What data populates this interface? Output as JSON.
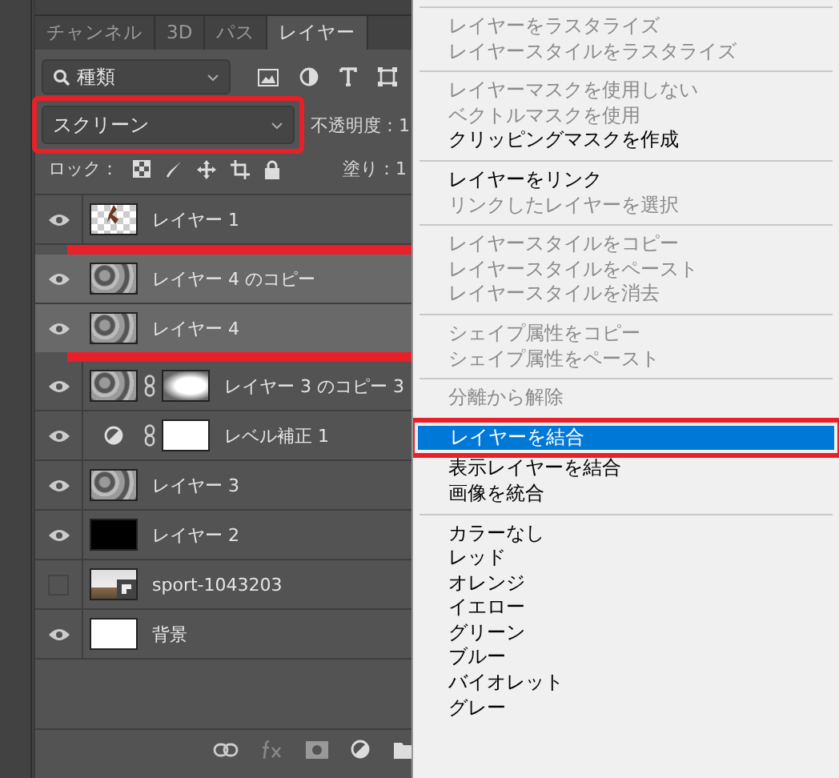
{
  "tabs": [
    {
      "label": "チャンネル",
      "selected": false
    },
    {
      "label": "3D",
      "selected": false
    },
    {
      "label": "パス",
      "selected": false
    },
    {
      "label": "レイヤー",
      "selected": true
    }
  ],
  "filter": {
    "value": "種類"
  },
  "blend_mode": {
    "value": "スクリーン",
    "highlighted": true
  },
  "opacity": {
    "label": "不透明度：1"
  },
  "lock": {
    "label": "ロック："
  },
  "fill": {
    "label": "塗り：1"
  },
  "layers": [
    {
      "name": "レイヤー 1",
      "visible": true,
      "selected": false,
      "highlighted": false,
      "kind": "figure"
    },
    {
      "name": "レイヤー 4 のコピー",
      "visible": true,
      "selected": true,
      "highlighted": true,
      "kind": "texture"
    },
    {
      "name": "レイヤー 4",
      "visible": true,
      "selected": true,
      "highlighted": true,
      "kind": "texture"
    },
    {
      "name": "レイヤー 3 のコピー 3",
      "visible": true,
      "selected": false,
      "highlighted": false,
      "kind": "texture",
      "mask": {
        "kind": "soft"
      }
    },
    {
      "name": "レベル補正 1",
      "visible": true,
      "selected": false,
      "highlighted": false,
      "kind": "adjustment",
      "mask": {
        "kind": "white"
      }
    },
    {
      "name": "レイヤー 3",
      "visible": true,
      "selected": false,
      "highlighted": false,
      "kind": "texture"
    },
    {
      "name": "レイヤー 2",
      "visible": true,
      "selected": false,
      "highlighted": false,
      "kind": "black"
    },
    {
      "name": "sport-1043203",
      "visible": false,
      "selected": false,
      "highlighted": false,
      "kind": "smart"
    },
    {
      "name": "背景",
      "visible": true,
      "selected": false,
      "highlighted": false,
      "kind": "white"
    }
  ],
  "menu": {
    "items": [
      {
        "kind": "separator"
      },
      {
        "kind": "item",
        "label": "レイヤーをラスタライズ",
        "disabled": true,
        "selected": false,
        "highlighted": false
      },
      {
        "kind": "item",
        "label": "レイヤースタイルをラスタライズ",
        "disabled": true,
        "selected": false,
        "highlighted": false
      },
      {
        "kind": "separator"
      },
      {
        "kind": "item",
        "label": "レイヤーマスクを使用しない",
        "disabled": true,
        "selected": false,
        "highlighted": false
      },
      {
        "kind": "item",
        "label": "ベクトルマスクを使用",
        "disabled": true,
        "selected": false,
        "highlighted": false
      },
      {
        "kind": "item",
        "label": "クリッピングマスクを作成",
        "disabled": false,
        "selected": false,
        "highlighted": false
      },
      {
        "kind": "separator"
      },
      {
        "kind": "item",
        "label": "レイヤーをリンク",
        "disabled": false,
        "selected": false,
        "highlighted": false
      },
      {
        "kind": "item",
        "label": "リンクしたレイヤーを選択",
        "disabled": true,
        "selected": false,
        "highlighted": false
      },
      {
        "kind": "separator"
      },
      {
        "kind": "item",
        "label": "レイヤースタイルをコピー",
        "disabled": true,
        "selected": false,
        "highlighted": false
      },
      {
        "kind": "item",
        "label": "レイヤースタイルをペースト",
        "disabled": true,
        "selected": false,
        "highlighted": false
      },
      {
        "kind": "item",
        "label": "レイヤースタイルを消去",
        "disabled": true,
        "selected": false,
        "highlighted": false
      },
      {
        "kind": "separator"
      },
      {
        "kind": "item",
        "label": "シェイプ属性をコピー",
        "disabled": true,
        "selected": false,
        "highlighted": false
      },
      {
        "kind": "item",
        "label": "シェイプ属性をペースト",
        "disabled": true,
        "selected": false,
        "highlighted": false
      },
      {
        "kind": "separator"
      },
      {
        "kind": "item",
        "label": "分離から解除",
        "disabled": true,
        "selected": false,
        "highlighted": false
      },
      {
        "kind": "separator"
      },
      {
        "kind": "item",
        "label": "レイヤーを結合",
        "disabled": false,
        "selected": true,
        "highlighted": true
      },
      {
        "kind": "item",
        "label": "表示レイヤーを結合",
        "disabled": false,
        "selected": false,
        "highlighted": false
      },
      {
        "kind": "item",
        "label": "画像を統合",
        "disabled": false,
        "selected": false,
        "highlighted": false
      },
      {
        "kind": "separator"
      },
      {
        "kind": "item",
        "label": "カラーなし",
        "disabled": false,
        "selected": false,
        "highlighted": false
      },
      {
        "kind": "item",
        "label": "レッド",
        "disabled": false,
        "selected": false,
        "highlighted": false
      },
      {
        "kind": "item",
        "label": "オレンジ",
        "disabled": false,
        "selected": false,
        "highlighted": false
      },
      {
        "kind": "item",
        "label": "イエロー",
        "disabled": false,
        "selected": false,
        "highlighted": false
      },
      {
        "kind": "item",
        "label": "グリーン",
        "disabled": false,
        "selected": false,
        "highlighted": false
      },
      {
        "kind": "item",
        "label": "ブルー",
        "disabled": false,
        "selected": false,
        "highlighted": false
      },
      {
        "kind": "item",
        "label": "バイオレット",
        "disabled": false,
        "selected": false,
        "highlighted": false
      },
      {
        "kind": "item",
        "label": "グレー",
        "disabled": false,
        "selected": false,
        "highlighted": false
      }
    ]
  }
}
